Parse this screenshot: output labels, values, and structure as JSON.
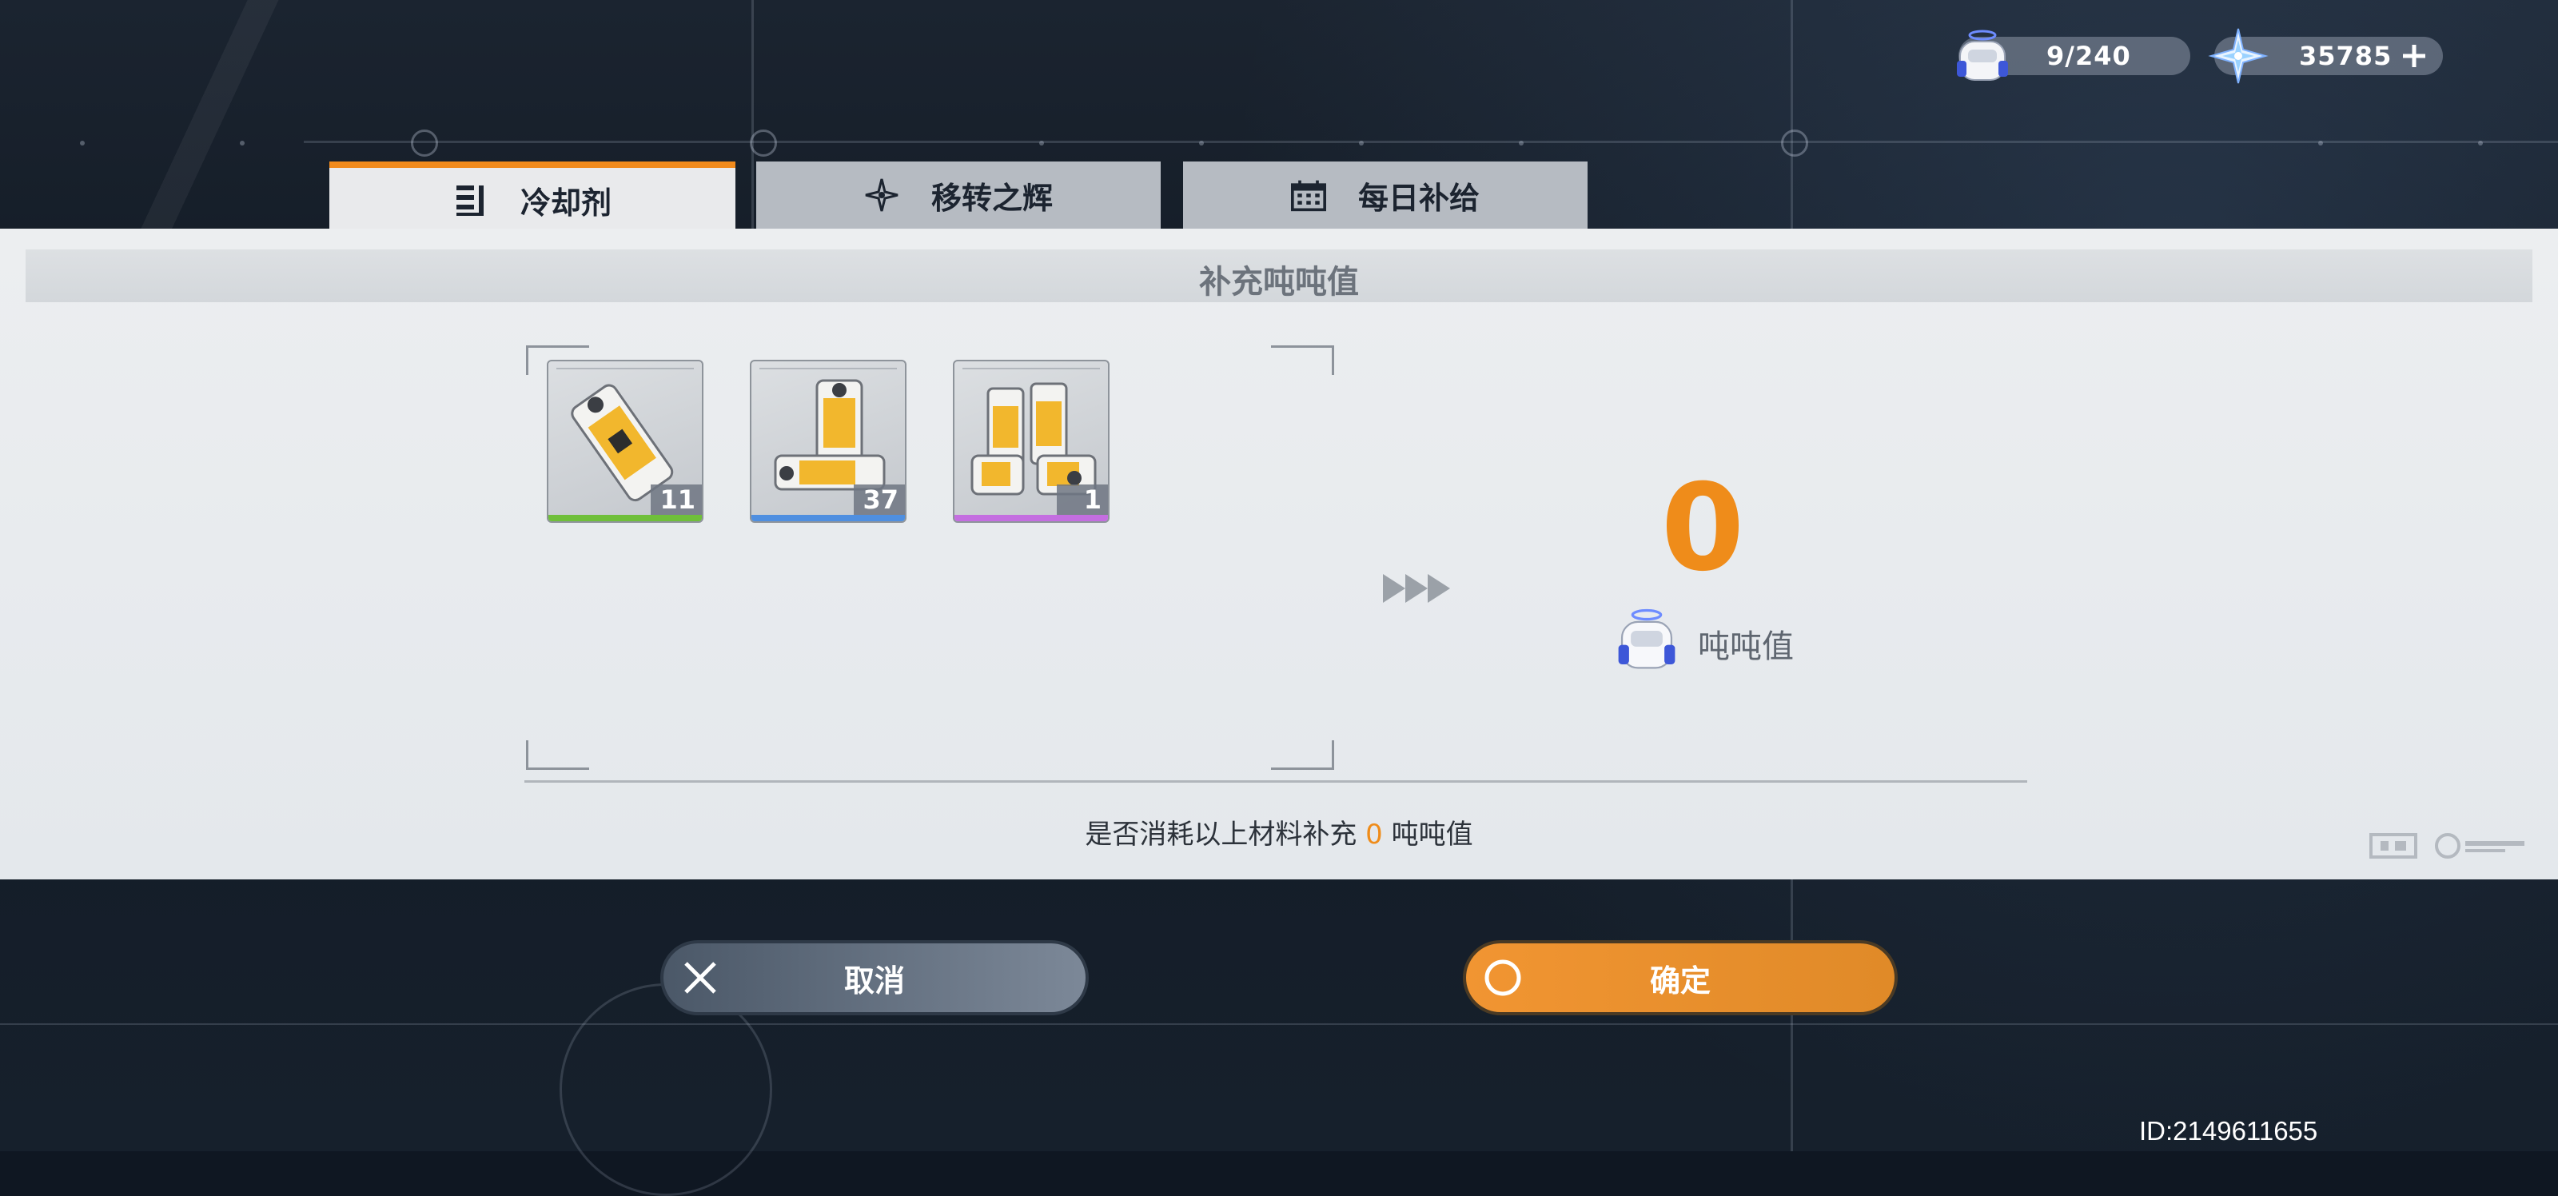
{
  "resources": {
    "stamina": {
      "value": "9/240",
      "icon": "robot-icon"
    },
    "crystals": {
      "value": "35785",
      "icon": "crystal-icon"
    }
  },
  "tabs": [
    {
      "label": "冷却剂",
      "icon": "coolant-list-icon",
      "active": true
    },
    {
      "label": "移转之辉",
      "icon": "star-icon",
      "active": false
    },
    {
      "label": "每日补给",
      "icon": "calendar-icon",
      "active": false
    }
  ],
  "panel": {
    "title": "补充吨吨值",
    "items": [
      {
        "count": "11",
        "rarity_color": "#6fbf3a"
      },
      {
        "count": "37",
        "rarity_color": "#4f8fe0"
      },
      {
        "count": "1",
        "rarity_color": "#c46ee0"
      }
    ],
    "result_value": "0",
    "result_label": "吨吨值",
    "confirm_prefix": "是否消耗以上材料补充",
    "confirm_value": "0",
    "confirm_suffix": "吨吨值"
  },
  "buttons": {
    "cancel": "取消",
    "ok": "确定"
  },
  "footer": {
    "id": "ID:2149611655"
  },
  "colors": {
    "accent": "#ef8c1a",
    "panel": "#eceef0"
  }
}
